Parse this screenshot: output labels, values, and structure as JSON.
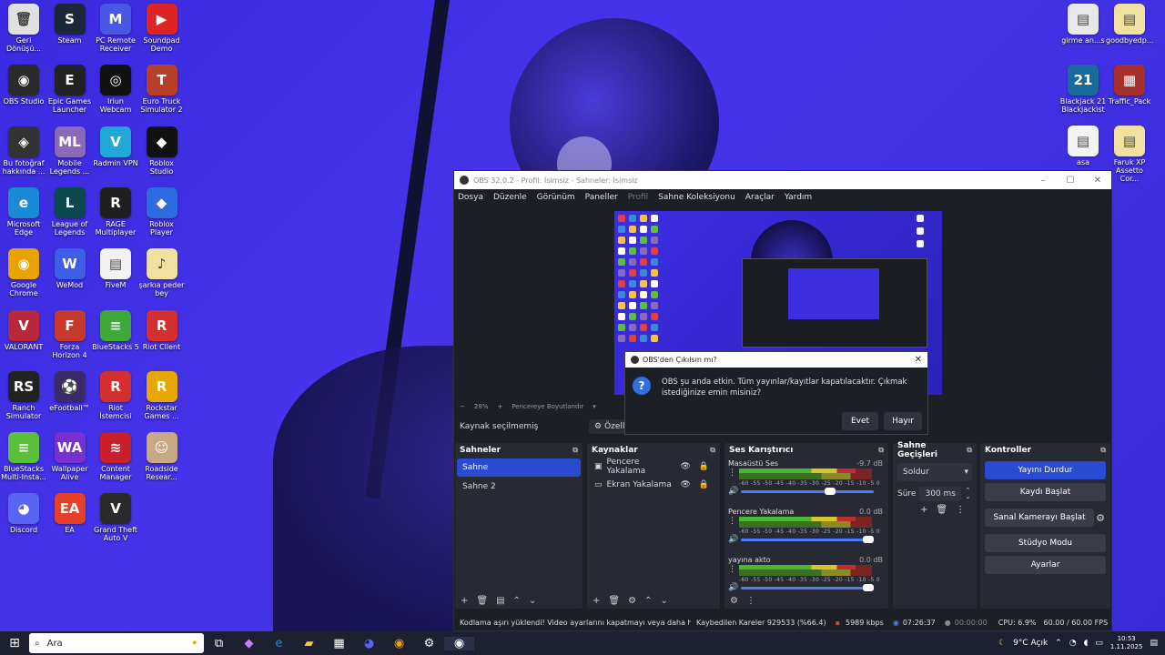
{
  "desktop_icons_left": [
    {
      "name": "recycle-bin-icon",
      "label": "Geri\nDönüşü...",
      "color": "#e0e0e0",
      "glyph": "🗑"
    },
    {
      "name": "steam-icon",
      "label": "Steam",
      "color": "#1b2838",
      "glyph": "S"
    },
    {
      "name": "pc-remote-icon",
      "label": "PC Remote\nReceiver",
      "color": "#4a57e6",
      "glyph": "M"
    },
    {
      "name": "soundpad-icon",
      "label": "Soundpad\nDemo",
      "color": "#e02424",
      "glyph": "▶"
    },
    {
      "name": "obs-studio-icon",
      "label": "OBS Studio",
      "color": "#2a2a2a",
      "glyph": "◉"
    },
    {
      "name": "epic-games-icon",
      "label": "Epic Games\nLauncher",
      "color": "#222222",
      "glyph": "E"
    },
    {
      "name": "iriun-webcam-icon",
      "label": "Iriun\nWebcam",
      "color": "#111111",
      "glyph": "◎"
    },
    {
      "name": "euro-truck-icon",
      "label": "Euro Truck\nSimulator 2",
      "color": "#b8402b",
      "glyph": "T"
    },
    {
      "name": "bu-fotograf-icon",
      "label": "Bu fotoğraf\nhakkında ...",
      "color": "#333333",
      "glyph": "◈"
    },
    {
      "name": "mobile-legends-icon",
      "label": "Mobile\nLegends ...",
      "color": "#8a6ab8",
      "glyph": "ML"
    },
    {
      "name": "radmin-vpn-icon",
      "label": "Radmin VPN",
      "color": "#21a8d9",
      "glyph": "V"
    },
    {
      "name": "roblox-studio-icon",
      "label": "Roblox\nStudio",
      "color": "#111111",
      "glyph": "◆"
    },
    {
      "name": "microsoft-edge-icon",
      "label": "Microsoft\nEdge",
      "color": "#1b8ad6",
      "glyph": "e"
    },
    {
      "name": "league-of-legends-icon",
      "label": "League of\nLegends",
      "color": "#0a4a4f",
      "glyph": "L"
    },
    {
      "name": "rage-multiplayer-icon",
      "label": "RAGE\nMultiplayer",
      "color": "#1f1f1f",
      "glyph": "R"
    },
    {
      "name": "roblox-player-icon",
      "label": "Roblox Player",
      "color": "#2c6be0",
      "glyph": "◆"
    },
    {
      "name": "google-chrome-icon",
      "label": "Google\nChrome",
      "color": "#e8a300",
      "glyph": "◉"
    },
    {
      "name": "wemod-icon",
      "label": "WeMod",
      "color": "#3f5ee8",
      "glyph": "W"
    },
    {
      "name": "fivem-icon",
      "label": "FiveM",
      "color": "#f2f2f2",
      "glyph": "▤"
    },
    {
      "name": "sarkici-file-icon",
      "label": "şarkıa peder\nbey",
      "color": "#f0e1a0",
      "glyph": "♪"
    },
    {
      "name": "valorant-icon",
      "label": "VALORANT",
      "color": "#b8283a",
      "glyph": "V"
    },
    {
      "name": "forza-horizon-icon",
      "label": "Forza\nHorizon 4",
      "color": "#c53a2a",
      "glyph": "F"
    },
    {
      "name": "bluestacks-icon",
      "label": "BlueStacks 5",
      "color": "#3fa83a",
      "glyph": "≡"
    },
    {
      "name": "riot-client-icon",
      "label": "Riot Client",
      "color": "#d32f2f",
      "glyph": "R"
    },
    {
      "name": "ranch-simulator-icon",
      "label": "Ranch\nSimulator",
      "color": "#222222",
      "glyph": "RS"
    },
    {
      "name": "efootball-icon",
      "label": "eFootball™",
      "color": "#3a2a6a",
      "glyph": "⚽"
    },
    {
      "name": "riot-istemcisi-icon",
      "label": "Riot İstemcisi",
      "color": "#d32f2f",
      "glyph": "R"
    },
    {
      "name": "rockstar-games-icon",
      "label": "Rockstar\nGames ...",
      "color": "#e6a800",
      "glyph": "R"
    },
    {
      "name": "bluestacks-multi-icon",
      "label": "BlueStacks\nMulti-Insta...",
      "color": "#5bbf3a",
      "glyph": "≡"
    },
    {
      "name": "wallpaper-alive-icon",
      "label": "Wallpaper\nAlive",
      "color": "#7a2fd0",
      "glyph": "WA"
    },
    {
      "name": "content-manager-icon",
      "label": "Content\nManager",
      "color": "#c8202a",
      "glyph": "≋"
    },
    {
      "name": "roadside-icon",
      "label": "Roadside\nResear...",
      "color": "#c9a885",
      "glyph": "☺"
    },
    {
      "name": "discord-icon",
      "label": "Discord",
      "color": "#5865f2",
      "glyph": "◕"
    },
    {
      "name": "ea-icon",
      "label": "EA",
      "color": "#e4402a",
      "glyph": "EA"
    },
    {
      "name": "gta-v-icon",
      "label": "Grand Theft\nAuto V",
      "color": "#2a2a2a",
      "glyph": "V"
    }
  ],
  "desktop_icons_right": [
    {
      "name": "girme-file-icon",
      "label": "girme an...s",
      "color": "#e8e8e8",
      "glyph": "▤"
    },
    {
      "name": "goodbyedp-file-icon",
      "label": "goodbyedp...",
      "color": "#f0e1a0",
      "glyph": "▤"
    },
    {
      "name": "blackjack-icon",
      "label": "Blackjack 21\nBlackjackist",
      "color": "#1a6a9a",
      "glyph": "21"
    },
    {
      "name": "traffic-pack-icon",
      "label": "Traffic_Pack",
      "color": "#a8302a",
      "glyph": "▦"
    },
    {
      "name": "asa-file-icon",
      "label": "asa",
      "color": "#f4f4f4",
      "glyph": "▤"
    },
    {
      "name": "faruk-xp-icon",
      "label": "Faruk XP\nAssetto Cor...",
      "color": "#f0e1a0",
      "glyph": "▤"
    }
  ],
  "obs": {
    "title": "OBS 32.0.2 - Profil: İsimsiz - Sahneler: İsimsiz",
    "menu": [
      "Dosya",
      "Düzenle",
      "Görünüm",
      "Paneller",
      "Profil",
      "Sahne Koleksiyonu",
      "Araçlar",
      "Yardım"
    ],
    "zoom": "28%",
    "zoom_mode": "Pencereye Boyutlandır",
    "no_source": "Kaynak seçilmemiş",
    "properties": "Özellik",
    "scenes_title": "Sahneler",
    "scenes": [
      "Sahne",
      "Sahne 2"
    ],
    "sources_title": "Kaynaklar",
    "sources": [
      "Pencere Yakalama",
      "Ekran Yakalama"
    ],
    "mixer_title": "Ses Karıştırıcı",
    "mixer": [
      {
        "name": "Masaüstü Ses",
        "db": "-9.7 dB",
        "level": 0.88,
        "vol": 0.71
      },
      {
        "name": "Pencere Yakalama",
        "db": "0.0 dB",
        "level": 0.88,
        "vol": 1.0
      },
      {
        "name": "yayına akto",
        "db": "0.0 dB",
        "level": 0.88,
        "vol": 1.0
      }
    ],
    "meter_scale": "-60 -55 -50 -45 -40 -35 -30 -25 -20 -15 -10 -5 0",
    "transitions_title": "Sahne Geçişleri",
    "transition": "Soldur",
    "duration_label": "Süre",
    "duration": "300 ms",
    "controls_title": "Kontroller",
    "controls": [
      "Yayını Durdur",
      "Kaydı Başlat",
      "Sanal Kamerayı Başlat",
      "Stüdyo Modu",
      "Ayarlar"
    ],
    "status": {
      "encoding": "Kodlama aşırı yüklendi! Video ayarlarını kapatmayı veya daha h",
      "dropped": "Kaybedilen Kareler 929533 (%66.4)",
      "bitrate": "5989 kbps",
      "stream_time": "07:26:37",
      "rec_time": "00:00:00",
      "cpu": "CPU: 6.9%",
      "fps": "60.00 / 60.00 FPS"
    }
  },
  "dialog": {
    "title": "OBS'den Çıkılsın mı?",
    "message": "OBS şu anda etkin. Tüm yayınlar/kayıtlar kapatılacaktır. Çıkmak istediğinize emin misiniz?",
    "yes": "Evet",
    "no": "Hayır"
  },
  "taskbar": {
    "search_placeholder": "Ara",
    "weather": "9°C  Açık",
    "time": "10:53",
    "date": "1.11.2025"
  }
}
